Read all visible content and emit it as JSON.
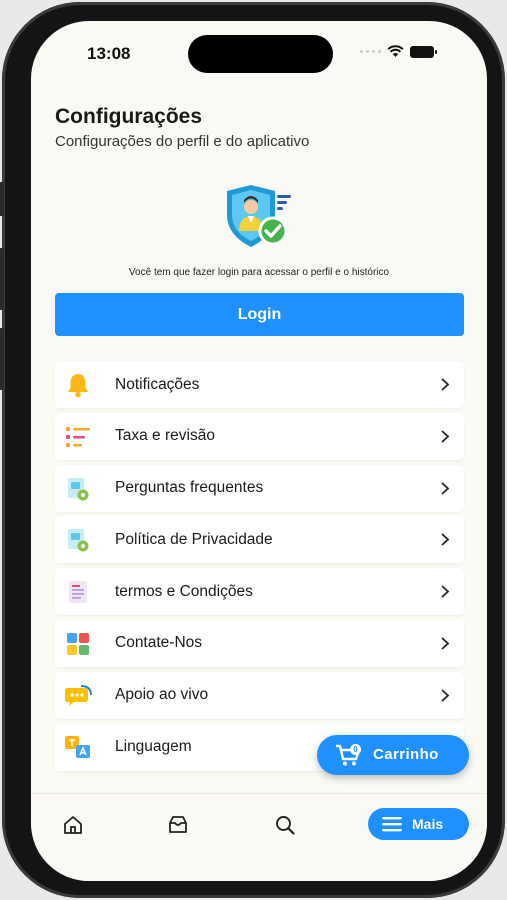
{
  "status": {
    "time": "13:08"
  },
  "header": {
    "title": "Configurações",
    "subtitle": "Configurações do perfil e do aplicativo"
  },
  "login": {
    "message": "Você tem que fazer login para acessar o perfil e o histórico",
    "button_label": "Login"
  },
  "menu": {
    "items": [
      {
        "label": "Notificações",
        "icon": "bell-icon"
      },
      {
        "label": "Taxa e revisão",
        "icon": "rating-list-icon"
      },
      {
        "label": "Perguntas frequentes",
        "icon": "faq-document-icon"
      },
      {
        "label": "Política de Privacidade",
        "icon": "privacy-document-icon"
      },
      {
        "label": "termos e Condições",
        "icon": "terms-document-icon"
      },
      {
        "label": "Contate-Nos",
        "icon": "contact-icon"
      },
      {
        "label": "Apoio ao vivo",
        "icon": "live-support-icon"
      },
      {
        "label": "Linguagem",
        "icon": "language-icon"
      }
    ]
  },
  "cart": {
    "label": "Carrinho",
    "count": "0"
  },
  "bottom_nav": {
    "items": [
      "home-icon",
      "orders-icon",
      "search-icon"
    ],
    "active_label": "Mais"
  },
  "colors": {
    "accent": "#1e90ff",
    "background": "#fbf9f3"
  }
}
